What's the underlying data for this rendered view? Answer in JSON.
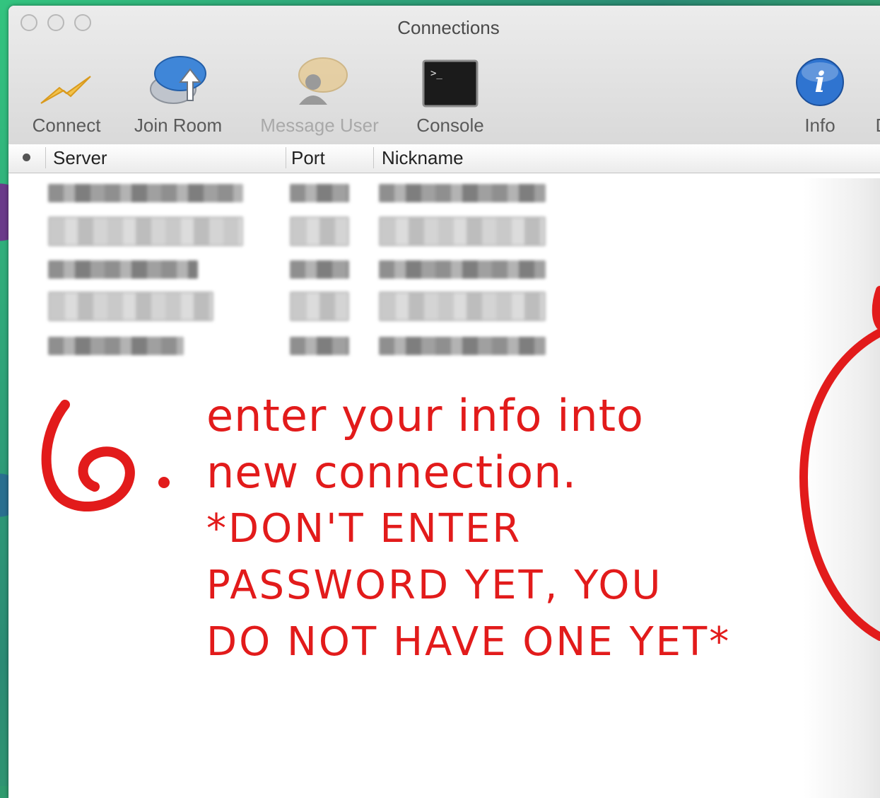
{
  "window": {
    "title": "Connections"
  },
  "toolbar": {
    "items": [
      {
        "label": "Connect",
        "icon": "lightning-bolt-icon",
        "enabled": true
      },
      {
        "label": "Join Room",
        "icon": "speech-bubble-arrow-icon",
        "enabled": true
      },
      {
        "label": "Message User",
        "icon": "user-message-icon",
        "enabled": false
      },
      {
        "label": "Console",
        "icon": "terminal-icon",
        "enabled": true
      },
      {
        "label": "Info",
        "icon": "info-icon",
        "enabled": true
      },
      {
        "label": "D",
        "icon": "",
        "enabled": true
      }
    ]
  },
  "table": {
    "columns": [
      "Server",
      "Port",
      "Nickname"
    ],
    "rows_note": "5 rows, content blurred out"
  },
  "annotation": {
    "step_number": "6.",
    "lines": [
      "enter your info into",
      "new connection.",
      "*DON'T ENTER",
      "PASSWORD YET, YOU",
      "DO NOT HAVE ONE YET*"
    ],
    "color": "#e21b1b"
  },
  "colors": {
    "accent_info": "#2f74d0",
    "annotation": "#e21b1b"
  }
}
